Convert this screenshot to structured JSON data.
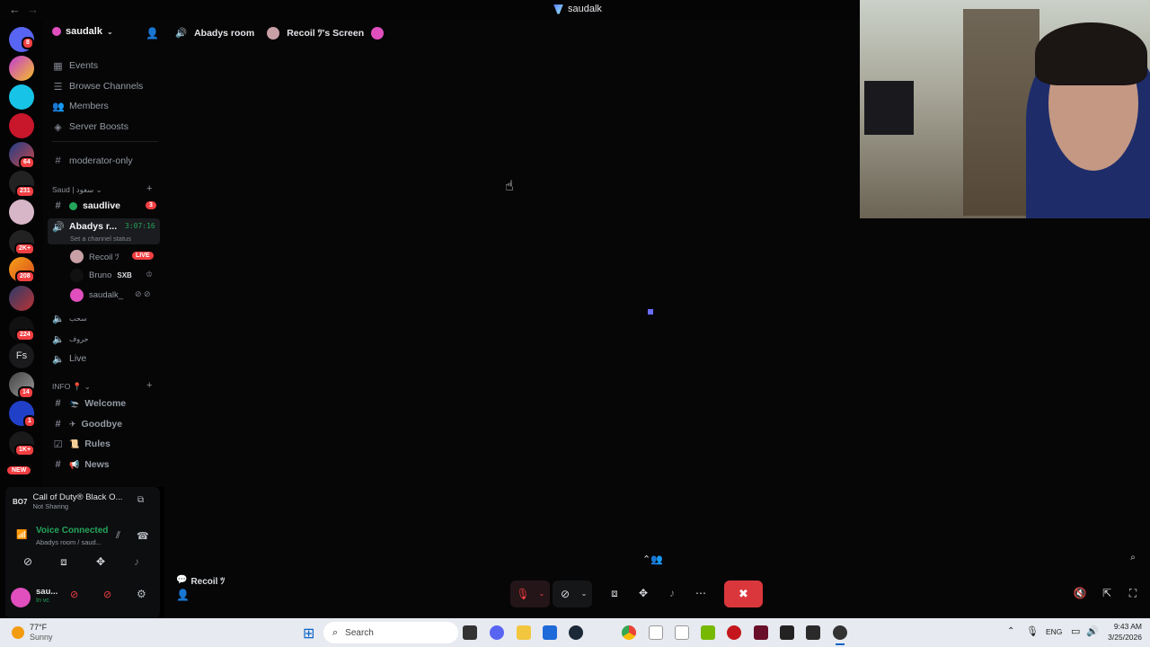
{
  "titlebar": {
    "title": "saudalk"
  },
  "server_rail": {
    "badges": {
      "s1": "8",
      "s6": "64",
      "s7": "231",
      "s9": "2K+",
      "s10": "208",
      "s12": "224",
      "s14": "14",
      "s15": "1",
      "s16": "1K+"
    },
    "fs_label": "Fs",
    "new_label": "NEW"
  },
  "sidebar": {
    "server_name": "saudalk",
    "nav": {
      "events": "Events",
      "browse": "Browse Channels",
      "members": "Members",
      "boosts": "Server Boosts"
    },
    "moderator": "moderator-only",
    "cat1": "Saud | سعود",
    "saudlive": "saudlive",
    "saudlive_badge": "3",
    "voice_name": "Abadys r...",
    "voice_timer": "3:07:16",
    "voice_status": "Set a channel status",
    "users": {
      "recoil": "Recoil ﾂ",
      "live": "LIVE",
      "bruno": "Bruno",
      "bruno_tag": "SXB",
      "saudalk": "saudalk_"
    },
    "v1": "سحب",
    "v2": "حروف",
    "live_ch": "Live",
    "cat2": "INFO 📍",
    "welcome": "Welcome",
    "goodbye": "Goodbye",
    "rules": "Rules",
    "news": "News"
  },
  "panel": {
    "game": "Call of Duty® Black O...",
    "not_sharing": "Not Sharing",
    "voice_connected": "Voice Connected",
    "voice_where": "Abadys room / saud...",
    "user_short": "sau...",
    "user_status": "In vc"
  },
  "stage": {
    "room": "Abadys room",
    "screen": "Recoil ﾂ's Screen",
    "recoil_label": "Recoil ﾂ"
  },
  "taskbar": {
    "temp": "77°F",
    "weather": "Sunny",
    "search": "Search",
    "lang": "ENG",
    "time": "9:43 AM",
    "date": "3/25/2026"
  }
}
